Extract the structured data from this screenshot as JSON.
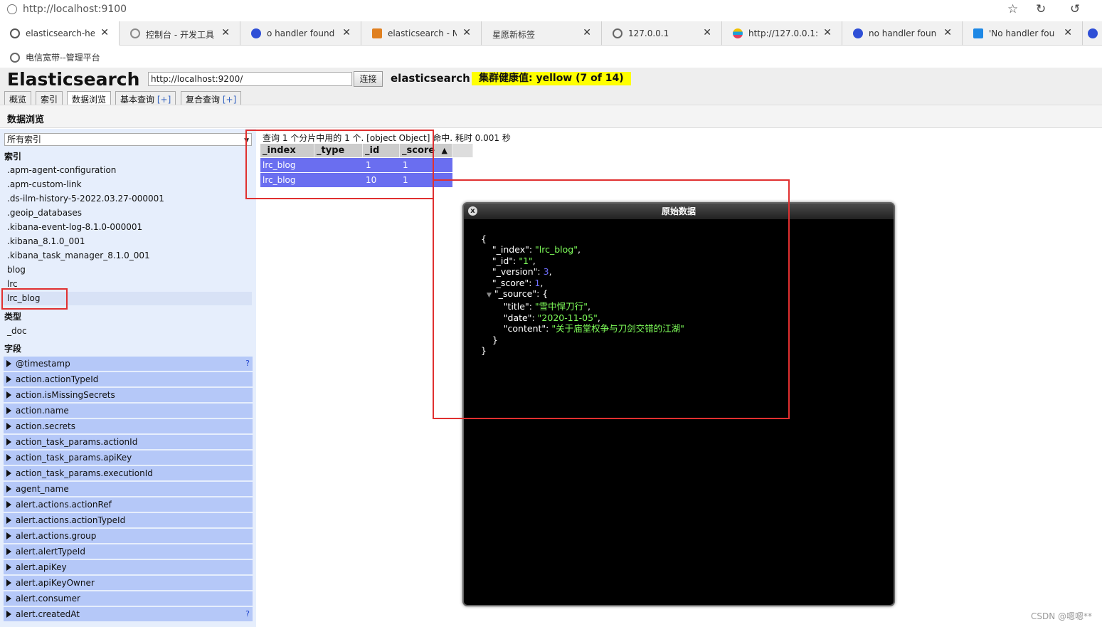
{
  "browser": {
    "url": "http://localhost:9100",
    "tabs": [
      {
        "label": "elasticsearch-he",
        "color": "#555555"
      },
      {
        "label": "控制台 - 开发工具",
        "color": "#8a8a8a"
      },
      {
        "label": "o handler found",
        "color": "#2f4fd6"
      },
      {
        "label": "elasticsearch - N",
        "color": "#e08020"
      },
      {
        "label": "星愿新标签",
        "color": ""
      },
      {
        "label": "127.0.0.1",
        "color": "#666666"
      },
      {
        "label": "http://127.0.0.1:",
        "color": "#1ea0d8"
      },
      {
        "label": "no handler foun",
        "color": "#2f4fd6"
      },
      {
        "label": "'No handler fou",
        "color": "#1e88e5"
      }
    ],
    "bookmark": "电信宽带--管理平台"
  },
  "app": {
    "title": "Elasticsearch",
    "url_value": "http://localhost:9200/",
    "connect_label": "连接",
    "cluster_name": "elasticsearch",
    "health": "集群健康值: yellow (7 of 14)",
    "tabs": [
      {
        "label": "概览",
        "plus": ""
      },
      {
        "label": "索引",
        "plus": ""
      },
      {
        "label": "数据浏览",
        "plus": ""
      },
      {
        "label": "基本查询 ",
        "plus": "[+]"
      },
      {
        "label": "复合查询 ",
        "plus": "[+]"
      }
    ],
    "section_title": "数据浏览"
  },
  "sidebar": {
    "select_value": "所有索引",
    "indices_heading": "索引",
    "indices": [
      ".apm-agent-configuration",
      ".apm-custom-link",
      ".ds-ilm-history-5-2022.03.27-000001",
      ".geoip_databases",
      ".kibana-event-log-8.1.0-000001",
      ".kibana_8.1.0_001",
      ".kibana_task_manager_8.1.0_001",
      "blog",
      "lrc",
      "lrc_blog"
    ],
    "types_heading": "类型",
    "types": [
      "_doc"
    ],
    "fields_heading": "字段",
    "fields": [
      "@timestamp",
      "action.actionTypeId",
      "action.isMissingSecrets",
      "action.name",
      "action.secrets",
      "action_task_params.actionId",
      "action_task_params.apiKey",
      "action_task_params.executionId",
      "agent_name",
      "alert.actions.actionRef",
      "alert.actions.actionTypeId",
      "alert.actions.group",
      "alert.alertTypeId",
      "alert.apiKey",
      "alert.apiKeyOwner",
      "alert.consumer",
      "alert.createdAt"
    ]
  },
  "results": {
    "summary": "查询 1 个分片中用的 1 个. [object Object] 命中. 耗时 0.001 秒",
    "columns": [
      "_index",
      "_type",
      "_id",
      "_score"
    ],
    "sort_indicator": "▲",
    "rows": [
      {
        "index": "lrc_blog",
        "type": "",
        "id": "1",
        "score": "1"
      },
      {
        "index": "lrc_blog",
        "type": "",
        "id": "10",
        "score": "1"
      }
    ]
  },
  "modal": {
    "title": "原始数据",
    "close": "x",
    "doc": {
      "_index": "lrc_blog",
      "_id": "1",
      "_version": "3",
      "_score": "1",
      "title": "雪中悍刀行",
      "date": "2020-11-05",
      "content": "关于庙堂权争与刀剑交错的江湖"
    }
  },
  "watermark": "CSDN @嗯嗯**"
}
